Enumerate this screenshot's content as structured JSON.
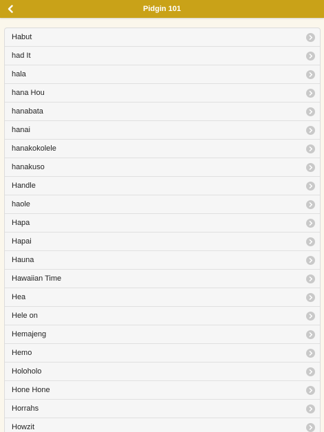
{
  "header": {
    "title": "Pidgin 101",
    "back_icon": "chevron-left-icon",
    "background_color": "#c9a218"
  },
  "list": {
    "item_icon": "chevron-right-circle-icon",
    "items": [
      {
        "label": "Habut"
      },
      {
        "label": "had It"
      },
      {
        "label": "hala"
      },
      {
        "label": "hana Hou"
      },
      {
        "label": "hanabata"
      },
      {
        "label": "hanai"
      },
      {
        "label": "hanakokolele"
      },
      {
        "label": "hanakuso"
      },
      {
        "label": "Handle"
      },
      {
        "label": "haole"
      },
      {
        "label": "Hapa"
      },
      {
        "label": "Hapai"
      },
      {
        "label": "Hauna"
      },
      {
        "label": "Hawaiian Time"
      },
      {
        "label": "Hea"
      },
      {
        "label": "Hele on"
      },
      {
        "label": "Hemajeng"
      },
      {
        "label": "Hemo"
      },
      {
        "label": "Holoholo"
      },
      {
        "label": "Hone Hone"
      },
      {
        "label": "Horrahs"
      },
      {
        "label": "Howzit"
      }
    ]
  }
}
